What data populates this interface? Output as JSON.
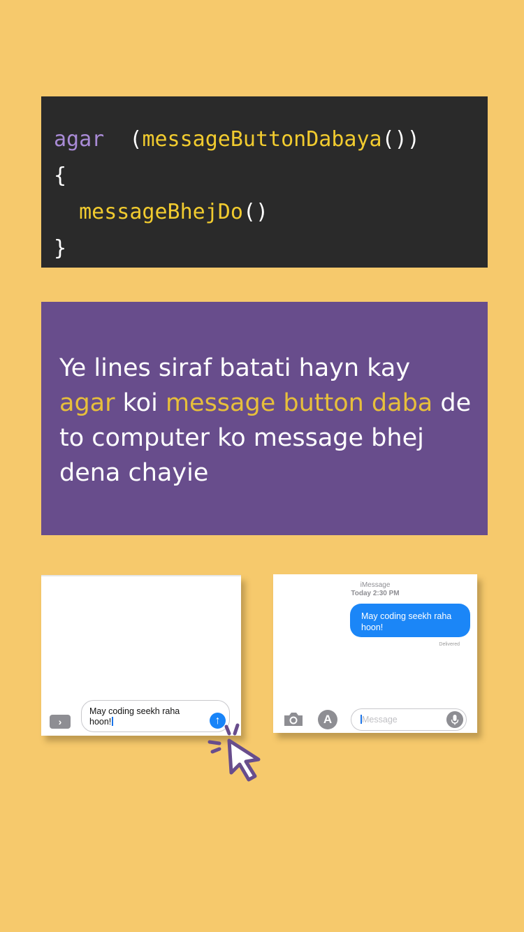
{
  "code": {
    "line1": {
      "keyword": "agar",
      "space": " ",
      "open": "(",
      "fn": "messageButtonDabaya",
      "parens": "())"
    },
    "line2": "{",
    "line3": {
      "indent": "  ",
      "fn": "messageBhejDo",
      "parens": "()"
    },
    "line4": "}"
  },
  "explanation": {
    "part1": "Ye lines siraf batati hayn kay",
    "highlight1": "agar",
    "part2": " koi ",
    "highlight2": "message button daba",
    "part3": " de to computer ko message bhej dena chayie"
  },
  "compose_screen": {
    "expand_glyph": "›",
    "draft_text": "May coding seekh raha hoon!",
    "send_glyph": "↑"
  },
  "imessage_screen": {
    "service": "iMessage",
    "timestamp": "Today 2:30 PM",
    "sent_message": "May coding seekh raha hoon!",
    "status": "Delivered",
    "input_placeholder": "Message",
    "appstore_glyph": "A"
  },
  "colors": {
    "background": "#f6c96c",
    "code_bg": "#2a2a2a",
    "keyword": "#a98bd6",
    "function": "#f1cb2f",
    "panel_purple": "#684d8c",
    "highlight": "#e7bf3b",
    "imessage_blue": "#1b86f7",
    "cursor": "#684d8c"
  },
  "icons": [
    "chevron-right-icon",
    "send-arrow-icon",
    "camera-icon",
    "app-store-icon",
    "microphone-icon",
    "click-cursor-icon"
  ]
}
